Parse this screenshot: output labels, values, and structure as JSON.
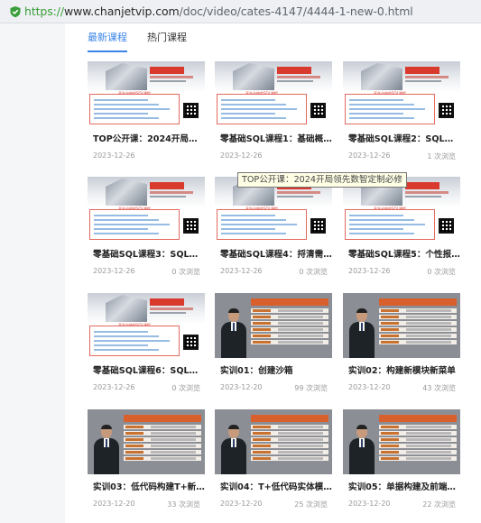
{
  "browser": {
    "url_scheme": "https://",
    "url_host": "www.chanjetvip.com",
    "url_path": "/doc/video/cates-4147/4444-1-new-0.html",
    "secure_color": "#3a9e3a"
  },
  "tabs": [
    {
      "label": "最新课程",
      "active": true
    },
    {
      "label": "热门课程",
      "active": false
    }
  ],
  "tooltip": "TOP公开课：2024开局领先数智定制必修",
  "thumb_text": "开年必修的SQL课程",
  "cards": [
    {
      "title": "TOP公开课：2024开局领先...",
      "date": "2023-12-26",
      "views": "",
      "thumb": "sql"
    },
    {
      "title": "零基础SQL课程1：基础概念(...",
      "date": "2023-12-26",
      "views": "",
      "thumb": "sql"
    },
    {
      "title": "零基础SQL课程2：SQL查询(...",
      "date": "2023-12-26",
      "views": "1 次浏览",
      "thumb": "sql"
    },
    {
      "title": "零基础SQL课程3：SQL更新(...",
      "date": "2023-12-26",
      "views": "0 次浏览",
      "thumb": "sql"
    },
    {
      "title": "零基础SQL课程4：捋清需求(...",
      "date": "2023-12-26",
      "views": "0 次浏览",
      "thumb": "sql"
    },
    {
      "title": "零基础SQL课程5：个性报表...",
      "date": "2023-12-26",
      "views": "0 次浏览",
      "thumb": "sql"
    },
    {
      "title": "零基础SQL课程6：SQL函数...",
      "date": "2023-12-26",
      "views": "0 次浏览",
      "thumb": "sql"
    },
    {
      "title": "实训01：创建沙箱",
      "date": "2023-12-20",
      "views": "99 次浏览",
      "thumb": "trainer"
    },
    {
      "title": "实训02：构建新模块新菜单",
      "date": "2023-12-20",
      "views": "43 次浏览",
      "thumb": "trainer"
    },
    {
      "title": "实训03：低代码构建T+新档案",
      "date": "2023-12-20",
      "views": "33 次浏览",
      "thumb": "trainer"
    },
    {
      "title": "实训04：T+低代码实体模型...",
      "date": "2023-12-20",
      "views": "25 次浏览",
      "thumb": "trainer"
    },
    {
      "title": "实训05：单据构建及前端交...",
      "date": "2023-12-20",
      "views": "22 次浏览",
      "thumb": "trainer"
    }
  ]
}
